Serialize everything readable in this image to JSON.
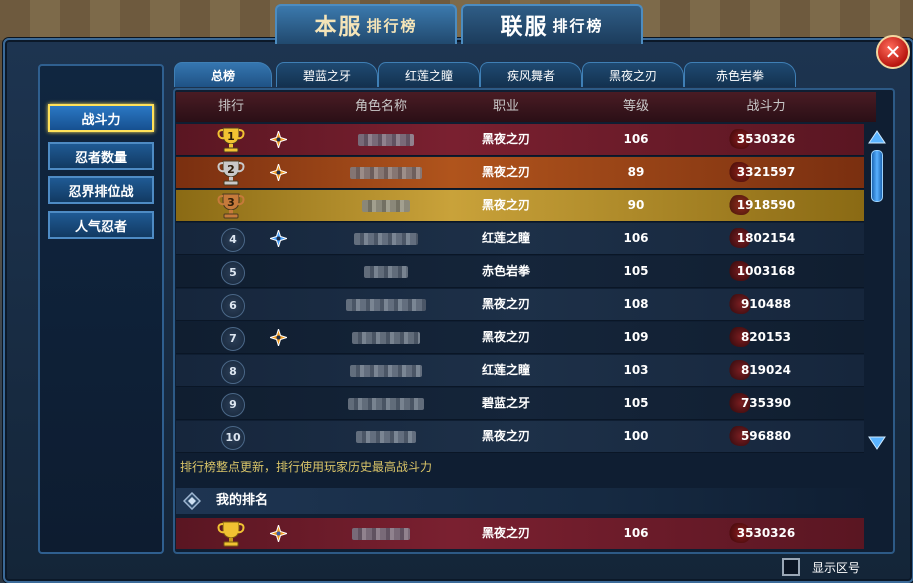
{
  "title_tabs": [
    {
      "label": "本服",
      "suffix": "排行榜",
      "active": true
    },
    {
      "label": "联服",
      "suffix": "排行榜",
      "active": false
    }
  ],
  "close_label": "✕",
  "categories": [
    {
      "label": "战斗力",
      "active": true
    },
    {
      "label": "忍者数量",
      "active": false
    },
    {
      "label": "忍界排位战",
      "active": false
    },
    {
      "label": "人气忍者",
      "active": false
    }
  ],
  "sub_tabs": [
    {
      "label": "总榜",
      "active": true
    },
    {
      "label": "碧蓝之牙",
      "active": false
    },
    {
      "label": "红莲之瞳",
      "active": false
    },
    {
      "label": "疾风舞者",
      "active": false
    },
    {
      "label": "黑夜之刃",
      "active": false
    },
    {
      "label": "赤色岩拳",
      "active": false
    }
  ],
  "columns": {
    "rank": "排行",
    "name": "角色名称",
    "job": "职业",
    "level": "等级",
    "power": "战斗力"
  },
  "rows": [
    {
      "rank": "1",
      "job": "黑夜之刃",
      "level": "106",
      "power": "3530326",
      "medal": "gold",
      "shuriken": "gold"
    },
    {
      "rank": "2",
      "job": "黑夜之刃",
      "level": "89",
      "power": "3321597",
      "medal": "silver",
      "shuriken": "gold"
    },
    {
      "rank": "3",
      "job": "黑夜之刃",
      "level": "90",
      "power": "1918590",
      "medal": "bronze",
      "shuriken": ""
    },
    {
      "rank": "4",
      "job": "红莲之瞳",
      "level": "106",
      "power": "1802154",
      "medal": "",
      "shuriken": "blue"
    },
    {
      "rank": "5",
      "job": "赤色岩拳",
      "level": "105",
      "power": "1003168",
      "medal": "",
      "shuriken": ""
    },
    {
      "rank": "6",
      "job": "黑夜之刃",
      "level": "108",
      "power": "910488",
      "medal": "",
      "shuriken": ""
    },
    {
      "rank": "7",
      "job": "黑夜之刃",
      "level": "109",
      "power": "820153",
      "medal": "",
      "shuriken": "gold"
    },
    {
      "rank": "8",
      "job": "红莲之瞳",
      "level": "103",
      "power": "819024",
      "medal": "",
      "shuriken": ""
    },
    {
      "rank": "9",
      "job": "碧蓝之牙",
      "level": "105",
      "power": "735390",
      "medal": "",
      "shuriken": ""
    },
    {
      "rank": "10",
      "job": "黑夜之刃",
      "level": "100",
      "power": "596880",
      "medal": "",
      "shuriken": ""
    }
  ],
  "note": "排行榜整点更新，排行使用玩家历史最高战斗力",
  "my_rank": {
    "label": "我的排名",
    "job": "黑夜之刃",
    "level": "106",
    "power": "3530326"
  },
  "show_zone_label": "显示区号",
  "colors": {
    "gold": "#f1c232",
    "silver": "#c9c9c9",
    "bronze": "#c67a3b",
    "accent": "#4e8bc4",
    "note": "#d9c468"
  }
}
